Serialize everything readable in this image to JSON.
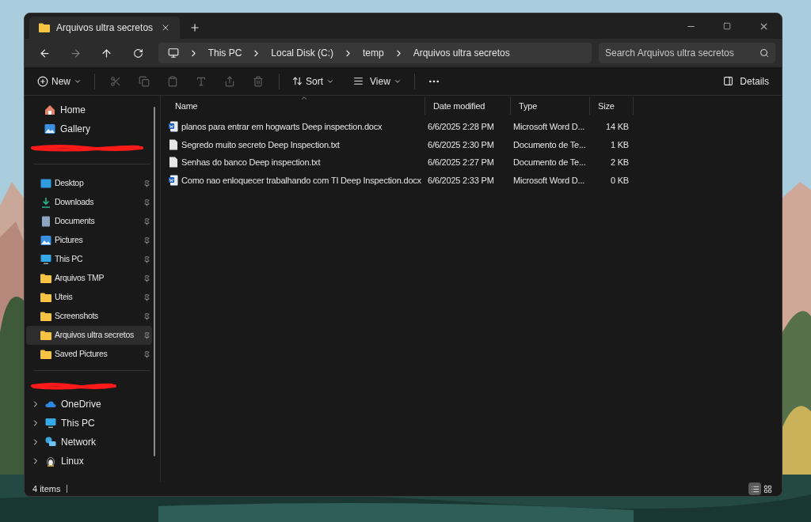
{
  "tab": {
    "title": "Arquivos ultra secretos",
    "selected": true
  },
  "breadcrumb": [
    "This PC",
    "Local Disk (C:)",
    "temp",
    "Arquivos ultra secretos"
  ],
  "search": {
    "placeholder": "Search Arquivos ultra secretos"
  },
  "toolbar": {
    "new": "New",
    "actions": [
      {
        "disabled": true
      },
      {
        "disabled": true
      },
      {
        "disabled": true
      },
      {
        "disabled": true
      },
      {
        "disabled": true
      },
      {
        "disabled": true
      }
    ],
    "sort": "Sort",
    "view": "View",
    "details": "Details"
  },
  "sidebar": {
    "top": [
      {
        "label": "Home",
        "selected": false
      },
      {
        "label": "Gallery",
        "selected": false
      }
    ],
    "quick_access": [
      {
        "label": "Desktop",
        "pinned": true,
        "selected": false
      },
      {
        "label": "Downloads",
        "pinned": true,
        "selected": false
      },
      {
        "label": "Documents",
        "pinned": true,
        "selected": false
      },
      {
        "label": "Pictures",
        "pinned": true,
        "selected": false
      },
      {
        "label": "This PC",
        "pinned": true,
        "selected": false
      },
      {
        "label": "Arquivos TMP",
        "pinned": true,
        "selected": false
      },
      {
        "label": "Uteis",
        "pinned": true,
        "selected": false
      },
      {
        "label": "Screenshots",
        "pinned": true,
        "selected": false
      },
      {
        "label": "Arquivos ultra secretos",
        "pinned": true,
        "selected": true
      },
      {
        "label": "Saved Pictures",
        "pinned": true,
        "selected": false
      }
    ],
    "tree": [
      {
        "label": "OneDrive",
        "expanded": false
      },
      {
        "label": "This PC",
        "expanded": false
      },
      {
        "label": "Network",
        "expanded": false
      },
      {
        "label": "Linux",
        "expanded": false
      }
    ]
  },
  "table": {
    "columns": [
      "Name",
      "Date modified",
      "Type",
      "Size"
    ],
    "rows": [
      {
        "kind": "word",
        "name": "planos para entrar em hogwarts Deep inspection.docx",
        "date": "6/6/2025 2:28 PM",
        "type": "Microsoft Word D...",
        "size": "14 KB"
      },
      {
        "kind": "text",
        "name": "Segredo muito secreto Deep Inspection.txt",
        "date": "6/6/2025 2:30 PM",
        "type": "Documento de Te...",
        "size": "1 KB"
      },
      {
        "kind": "text",
        "name": "Senhas do banco Deep inspection.txt",
        "date": "6/6/2025 2:27 PM",
        "type": "Documento de Te...",
        "size": "2 KB"
      },
      {
        "kind": "word",
        "name": "Como nao enloquecer trabalhando com TI Deep Inspection.docx",
        "date": "6/6/2025 2:33 PM",
        "type": "Microsoft Word D...",
        "size": "0 KB"
      }
    ]
  },
  "status_bar": {
    "count": "4 items",
    "views": [
      {
        "selected": true
      },
      {
        "selected": false
      }
    ]
  }
}
